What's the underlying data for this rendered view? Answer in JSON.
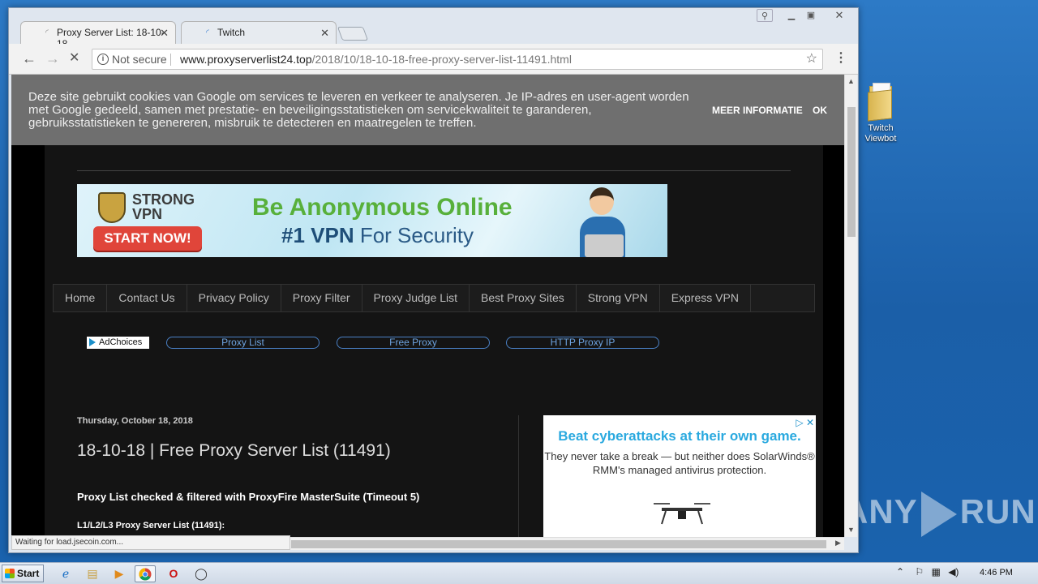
{
  "browser": {
    "tabs": [
      {
        "title": "Proxy Server List: 18-10-18"
      },
      {
        "title": "Twitch"
      }
    ],
    "address": {
      "security": "Not secure",
      "host": "www.proxyserverlist24.top",
      "path": "/2018/10/18-10-18-free-proxy-server-list-11491.html"
    },
    "status": "Waiting for load.jsecoin.com..."
  },
  "cookie_banner": {
    "text": "Deze site gebruikt cookies van Google om services te leveren en verkeer te analyseren. Je IP-adres en user-agent worden met Google gedeeld, samen met prestatie- en beveiligingsstatistieken om servicekwaliteit te garanderen, gebruiksstatistieken te genereren, misbruik te detecteren en maatregelen te treffen.",
    "more_label": "MEER INFORMATIE",
    "ok_label": "OK"
  },
  "banner_ad": {
    "brand_line1": "STRONG",
    "brand_line2": "VPN",
    "cta": "START NOW!",
    "headline": "Be Anonymous Online",
    "subline_strong": "#1 VPN",
    "subline_rest": " For Security"
  },
  "nav": {
    "items": [
      "Home",
      "Contact Us",
      "Privacy Policy",
      "Proxy Filter",
      "Proxy Judge List",
      "Best Proxy Sites",
      "Strong VPN",
      "Express VPN"
    ]
  },
  "ad_links": {
    "adchoices": "AdChoices",
    "links": [
      "Proxy List",
      "Free Proxy",
      "HTTP Proxy IP"
    ]
  },
  "post": {
    "date": "Thursday, October 18, 2018",
    "title": "18-10-18 | Free Proxy Server List (11491)",
    "subtitle": "Proxy List checked & filtered with ProxyFire MasterSuite (Timeout 5)",
    "list_heading": "L1/L2/L3 Proxy Server List (11491):"
  },
  "side_ad": {
    "headline": "Beat cyberattacks at their own game.",
    "body": "They never take a break — but neither does SolarWinds® RMM's managed antivirus protection."
  },
  "desktop": {
    "icon_label_1": "Twitch",
    "icon_label_2": "Viewbot",
    "watermark_a": "ANY",
    "watermark_b": "RUN"
  },
  "taskbar": {
    "start_label": "Start",
    "clock": "4:46 PM"
  }
}
